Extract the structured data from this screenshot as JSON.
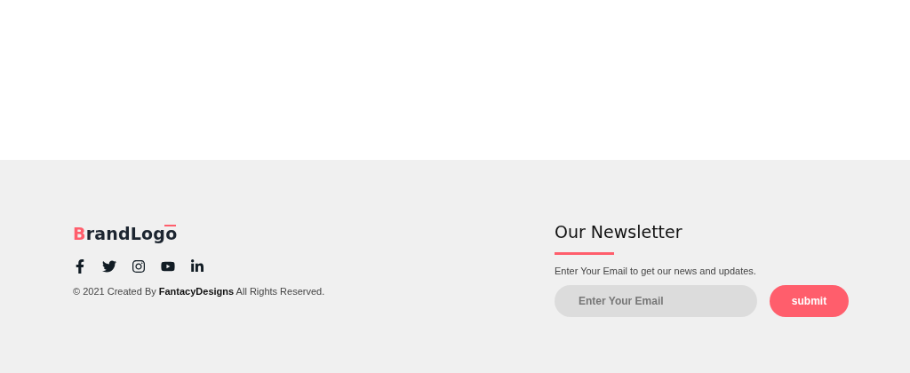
{
  "footer": {
    "logo": {
      "accent": "B",
      "rest": "randLogo"
    },
    "copyright": "© 2021 Created By **FantacyDesigns** All Rights Reserved.",
    "newsletter": {
      "title": "Our Newsletter",
      "text": "Enter Your Email to get our news and updates.",
      "email": {
        "placeholder": "Enter Your Email"
      },
      "button": "submit"
    }
  }
}
